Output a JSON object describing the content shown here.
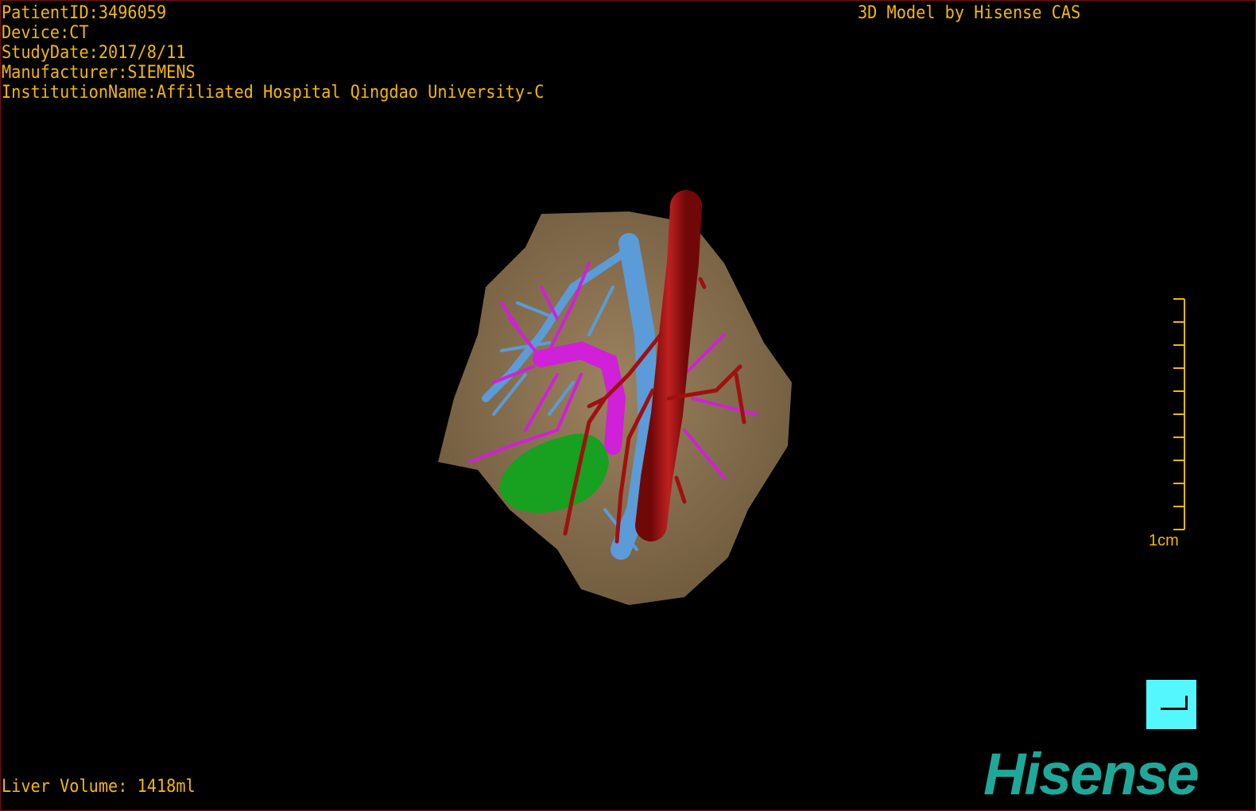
{
  "info": {
    "patient_id": "PatientID:3496059",
    "device": "Device:CT",
    "study_date": "StudyDate:2017/8/11",
    "manufacturer": "Manufacturer:SIEMENS",
    "institution": "InstitutionName:Affiliated Hospital Qingdao University-C"
  },
  "brand_caption": "3D Model by Hisense CAS",
  "liver_volume": "Liver Volume: 1418ml",
  "scale": {
    "label": "1cm",
    "ticks": 11
  },
  "logo": "Hisense",
  "colors": {
    "overlay_text": "#f5b800",
    "liver": "#8a7250",
    "artery": "#a01010",
    "portal_vein": "#d020d8",
    "hepatic_vein": "#5b9bd8",
    "gallbladder": "#18a020",
    "orientation_button": "#55f7ff",
    "logo": "#1fa89a"
  },
  "icons": {
    "orientation": "corner-bracket-icon"
  }
}
